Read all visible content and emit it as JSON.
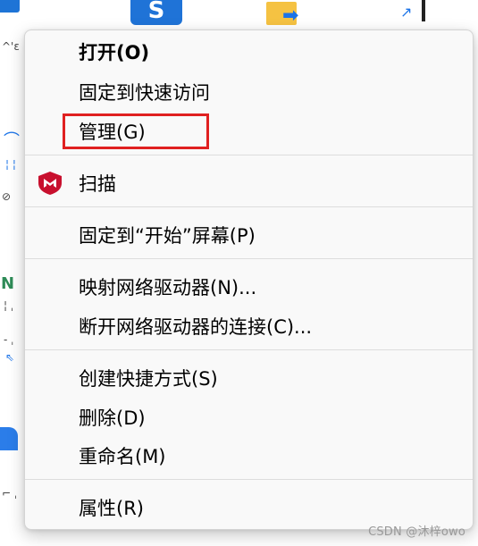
{
  "menu": {
    "items": [
      {
        "label": "打开(O)",
        "bold": true
      },
      {
        "label": "固定到快速访问"
      },
      {
        "label": "管理(G)",
        "highlighted": true
      },
      {
        "label": "扫描",
        "icon": "mcafee-shield-icon"
      },
      {
        "label": "固定到“开始”屏幕(P)"
      },
      {
        "label": "映射网络驱动器(N)..."
      },
      {
        "label": "断开网络驱动器的连接(C)..."
      },
      {
        "label": "创建快捷方式(S)"
      },
      {
        "label": "删除(D)"
      },
      {
        "label": "重命名(M)"
      },
      {
        "label": "属性(R)"
      }
    ],
    "highlight_color": "#e02020",
    "scan_icon_color": "#c8102e"
  },
  "desktop": {
    "fragments": {
      "frag_a": "^'ɛ",
      "frag_b": "⊘",
      "frag_c": "N",
      "frag_d": "⇖"
    }
  },
  "watermark": "CSDN @沐梓owo"
}
